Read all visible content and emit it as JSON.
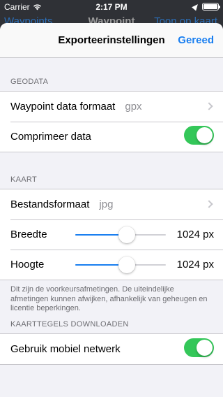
{
  "status_bar": {
    "carrier": "Carrier",
    "time": "2:17 PM",
    "battery_level": 1.0
  },
  "background_nav": {
    "back_label": "Waypoints",
    "title": "Waypoint",
    "right_label": "Toon op kaart"
  },
  "sheet": {
    "title": "Exporteerinstellingen",
    "done_label": "Gereed"
  },
  "geodata": {
    "header": "GEODATA",
    "format_label": "Waypoint data formaat",
    "format_value": "gpx",
    "compress_label": "Comprimeer data",
    "compress_on": true
  },
  "kaart": {
    "header": "KAART",
    "file_format_label": "Bestandsformaat",
    "file_format_value": "jpg",
    "width_label": "Breedte",
    "width_value": "1024 px",
    "width_slider": 0.57,
    "height_label": "Hoogte",
    "height_value": "1024 px",
    "height_slider": 0.57,
    "footer": "Dit zijn de voorkeursafmetingen. De uiteindelijke afmetingen kunnen afwijken, afhankelijk van geheugen en licentie beperkingen."
  },
  "tiles": {
    "header": "KAARTTEGELS DOWNLOADEN",
    "mobile_label": "Gebruik mobiel netwerk",
    "mobile_on": true
  },
  "colors": {
    "accent": "#1a7ff0",
    "toggle_on": "#34c759"
  }
}
